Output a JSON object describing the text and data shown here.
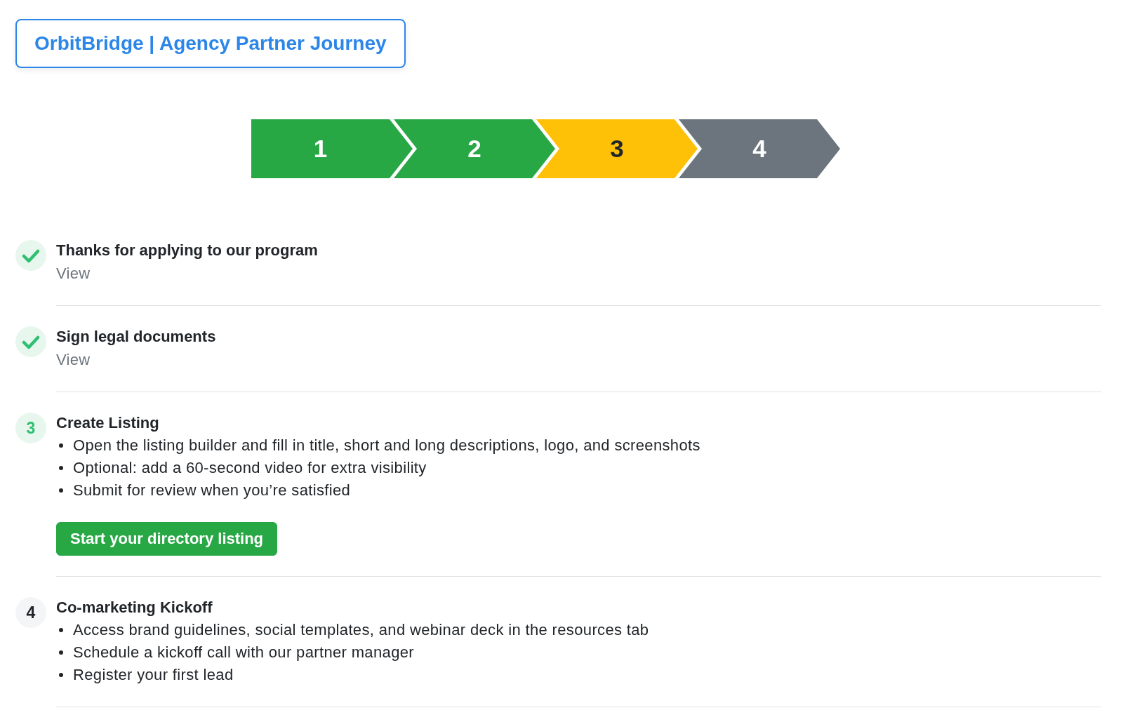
{
  "header": {
    "title": "OrbitBridge | Agency Partner Journey"
  },
  "progress": [
    {
      "label": "1",
      "completed": true,
      "active": false
    },
    {
      "label": "2",
      "completed": true,
      "active": false
    },
    {
      "label": "3",
      "completed": false,
      "active": true
    },
    {
      "label": "4",
      "completed": false,
      "active": false
    }
  ],
  "steps": [
    {
      "completed": true,
      "active": false,
      "title": "Thanks for applying to our program",
      "link": "View"
    },
    {
      "completed": true,
      "active": false,
      "title": "Sign legal documents",
      "link": "View"
    },
    {
      "completed": false,
      "active": true,
      "number": "3",
      "title": "Create Listing",
      "bullets": [
        "Open the listing builder and fill in title, short and long descriptions, logo, and screenshots",
        "Optional: add a 60-second video for extra visibility",
        "Submit for review when you’re satisfied"
      ],
      "button": "Start your directory listing"
    },
    {
      "completed": false,
      "active": false,
      "number": "4",
      "title": "Co-marketing Kickoff",
      "bullets": [
        "Access brand guidelines, social templates, and webinar deck in the resources tab",
        "Schedule a kickoff call with our partner manager",
        "Register your first lead"
      ]
    }
  ]
}
